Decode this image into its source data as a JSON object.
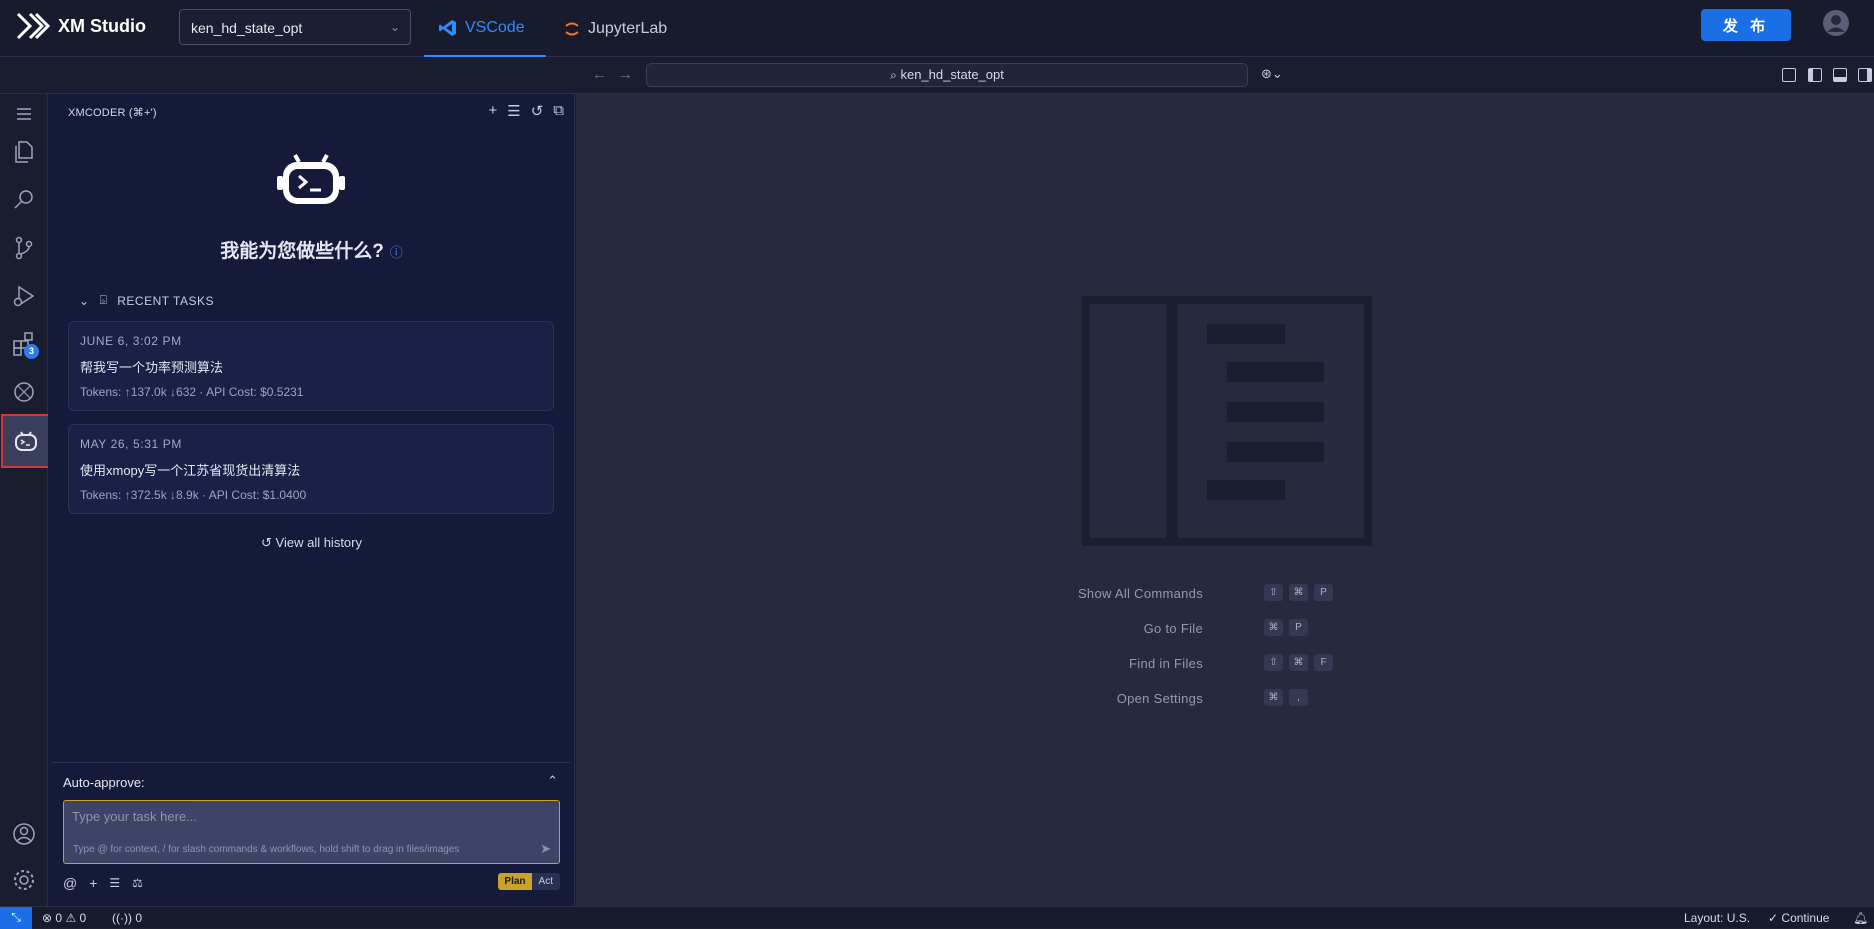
{
  "app": {
    "name": "XM Studio"
  },
  "header": {
    "project": "ken_hd_state_opt",
    "tabs": [
      {
        "label": "VSCode",
        "active": true
      },
      {
        "label": "JupyterLab",
        "active": false
      }
    ],
    "publish_label": "发 布"
  },
  "commandbar": {
    "search_text": "ken_hd_state_opt"
  },
  "activity": {
    "extensions_badge": "3"
  },
  "panel": {
    "title": "XMCODER (⌘+')",
    "welcome": "我能为您做些什么?",
    "recent_label": "RECENT TASKS",
    "tasks": [
      {
        "date": "JUNE 6, 3:02 PM",
        "title": "帮我写一个功率预测算法",
        "meta": "Tokens: ↑137.0k ↓632 · API Cost: $0.5231"
      },
      {
        "date": "MAY 26, 5:31 PM",
        "title": "使用xmopy写一个江苏省现货出清算法",
        "meta": "Tokens: ↑372.5k ↓8.9k · API Cost: $1.0400"
      }
    ],
    "view_history": "View all history",
    "auto_approve": "Auto-approve:",
    "input_placeholder": "Type your task here...",
    "input_hint": "Type @ for context, / for slash commands & workflows, hold shift to drag in files/images",
    "mode_plan": "Plan",
    "mode_act": "Act"
  },
  "editor": {
    "shortcuts": [
      {
        "label": "Show All Commands",
        "keys": [
          "⇧",
          "⌘",
          "P"
        ]
      },
      {
        "label": "Go to File",
        "keys": [
          "⌘",
          "P"
        ]
      },
      {
        "label": "Find in Files",
        "keys": [
          "⇧",
          "⌘",
          "F"
        ]
      },
      {
        "label": "Open Settings",
        "keys": [
          "⌘",
          ","
        ]
      }
    ]
  },
  "statusbar": {
    "errors": "0",
    "warnings": "0",
    "ports": "0",
    "layout": "Layout: U.S.",
    "continue": "Continue"
  },
  "colors": {
    "accent": "#1a6ee6",
    "highlight": "#e0313c",
    "plan": "#c9a227"
  }
}
